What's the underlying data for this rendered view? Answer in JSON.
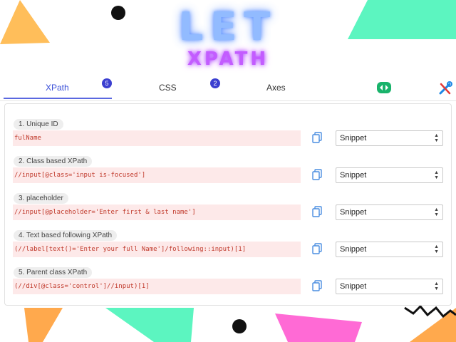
{
  "branding": {
    "title": "LET",
    "subtitle": "XPATH"
  },
  "tabs": [
    {
      "label": "XPath",
      "badge": "5"
    },
    {
      "label": "CSS",
      "badge": "2"
    },
    {
      "label": "Axes"
    }
  ],
  "icons": {
    "extension": "code-arrows-icon",
    "settings": "tools-icon",
    "copy": "copy-icon"
  },
  "rows": [
    {
      "label": "1. Unique ID",
      "value": "fulName",
      "snippet": "Snippet"
    },
    {
      "label": "2. Class based XPath",
      "value": "//input[@class='input is-focused']",
      "snippet": "Snippet"
    },
    {
      "label": "3. placeholder",
      "value": "//input[@placeholder='Enter first & last name']",
      "snippet": "Snippet"
    },
    {
      "label": "4. Text based following XPath",
      "value": "(//label[text()='Enter your full Name']/following::input)[1]",
      "snippet": "Snippet"
    },
    {
      "label": "5. Parent class XPath",
      "value": "(//div[@class='control']//input)[1]",
      "snippet": "Snippet"
    }
  ],
  "colors": {
    "accent": "#3b3fd0",
    "code_text": "#c0392b",
    "code_bg": "#fde9e9"
  }
}
